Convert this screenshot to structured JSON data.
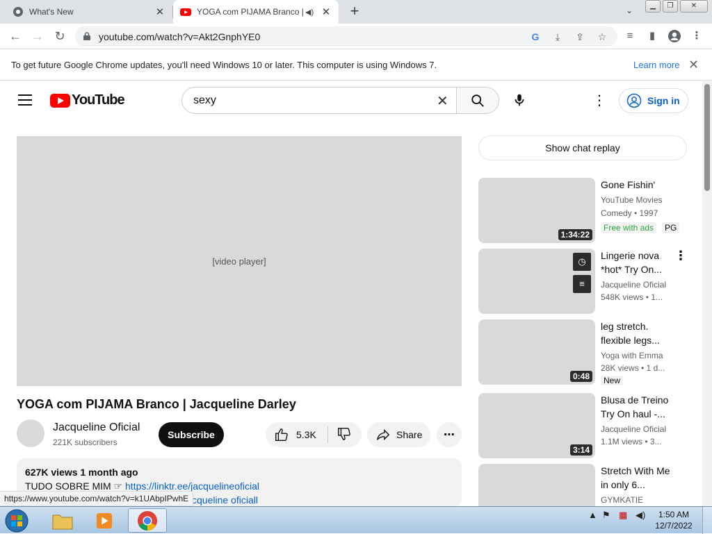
{
  "browser": {
    "tabs": [
      {
        "title": "What's New",
        "active": false
      },
      {
        "title": "YOGA com PIJAMA Branco | Jacqueline Darley",
        "active": true
      }
    ],
    "url": "youtube.com/watch?v=Akt2GnphYE0",
    "infobar": {
      "message": "To get future Google Chrome updates, you'll need Windows 10 or later. This computer is using Windows 7.",
      "link": "Learn more"
    },
    "status_url": "https://www.youtube.com/watch?v=k1UAbpIPwhE"
  },
  "youtube": {
    "logo_text": "YouTube",
    "search_value": "sexy",
    "signin_label": "Sign in",
    "video": {
      "title": "YOGA com PIJAMA Branco | Jacqueline Darley",
      "channel": "Jacqueline Oficial",
      "subscribers": "221K subscribers",
      "subscribe_label": "Subscribe",
      "likes": "5.3K",
      "share_label": "Share",
      "stats": "627K views  1 month ago",
      "desc_prefix": "TUDO SOBRE MIM ☞ ",
      "desc_link": "https://linktr.ee/jacquelineoficial",
      "desc_line2": "cqueline oficiall",
      "thumb_placeholder": "[video player]"
    },
    "chat_replay_label": "Show chat replay",
    "recommendations": [
      {
        "title": "Gone Fishin'",
        "channel": "YouTube Movies",
        "meta": "Comedy • 1997",
        "duration": "1:34:22",
        "badge1": "Free with ads",
        "badge2": "PG"
      },
      {
        "title": "Lingerie nova *hot* Try On...",
        "channel": "Jacqueline Oficial",
        "meta": "548K views • 1...",
        "duration": ""
      },
      {
        "title": "leg stretch. flexible legs...",
        "channel": "Yoga with Emma",
        "meta": "28K views • 1 d...",
        "duration": "0:48",
        "badge1": "New"
      },
      {
        "title": "Blusa de Treino Try On haul -...",
        "channel": "Jacqueline Oficial",
        "meta": "1.1M views • 3...",
        "duration": "3:14"
      },
      {
        "title": "Stretch With Me in only 6...",
        "channel": "GYMKATIE",
        "meta": "",
        "duration": ""
      }
    ]
  },
  "taskbar": {
    "time": "1:50 AM",
    "date": "12/7/2022"
  },
  "colors": {
    "youtube_red": "#ff0000",
    "link_blue": "#065fd4",
    "chrome_blue": "#1a73e8"
  }
}
